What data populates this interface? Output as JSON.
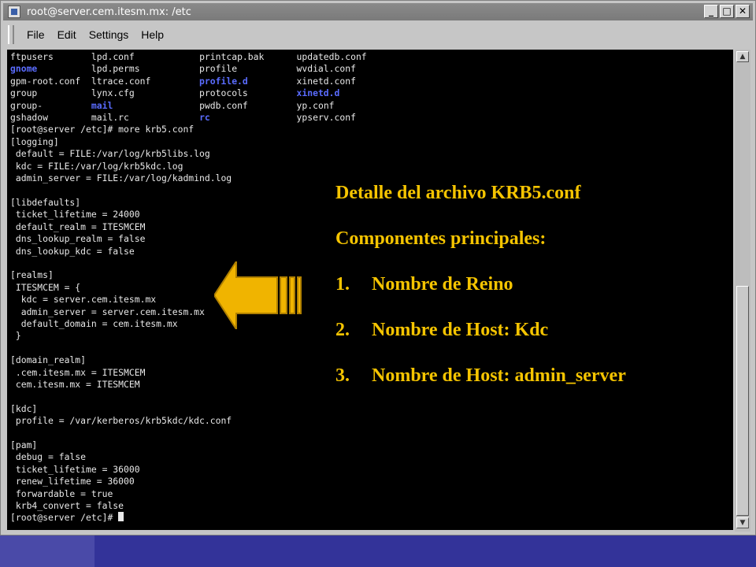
{
  "window": {
    "title": "root@server.cem.itesm.mx: /etc",
    "buttons": {
      "minimize": "_",
      "maximize": "□",
      "close": "✕"
    }
  },
  "menu": [
    "File",
    "Edit",
    "Settings",
    "Help"
  ],
  "terminal": {
    "listing": [
      [
        "ftpusers",
        "lpd.conf",
        "printcap.bak",
        "updatedb.conf"
      ],
      [
        "gnome",
        "lpd.perms",
        "profile",
        "wvdial.conf"
      ],
      [
        "gpm-root.conf",
        "ltrace.conf",
        "profile.d",
        "xinetd.conf"
      ],
      [
        "group",
        "lynx.cfg",
        "protocols",
        "xinetd.d"
      ],
      [
        "group-",
        "mail",
        "pwdb.conf",
        "yp.conf"
      ],
      [
        "gshadow",
        "mail.rc",
        "rc",
        "ypserv.conf"
      ]
    ],
    "lines": [
      "[root@server /etc]# more krb5.conf",
      "[logging]",
      " default = FILE:/var/log/krb5libs.log",
      " kdc = FILE:/var/log/krb5kdc.log",
      " admin_server = FILE:/var/log/kadmind.log",
      "",
      "[libdefaults]",
      " ticket_lifetime = 24000",
      " default_realm = ITESMCEM",
      " dns_lookup_realm = false",
      " dns_lookup_kdc = false",
      "",
      "[realms]",
      " ITESMCEM = {",
      "  kdc = server.cem.itesm.mx",
      "  admin_server = server.cem.itesm.mx",
      "  default_domain = cem.itesm.mx",
      " }",
      "",
      "[domain_realm]",
      " .cem.itesm.mx = ITESMCEM",
      " cem.itesm.mx = ITESMCEM",
      "",
      "[kdc]",
      " profile = /var/kerberos/krb5kdc/kdc.conf",
      "",
      "[pam]",
      " debug = false",
      " ticket_lifetime = 36000",
      " renew_lifetime = 36000",
      " forwardable = true",
      " krb4_convert = false"
    ],
    "prompt": "[root@server /etc]# "
  },
  "overlay": {
    "heading": "Detalle del archivo KRB5.conf",
    "subheading": "Componentes principales:",
    "items": [
      {
        "num": "1.",
        "text": "Nombre de Reino"
      },
      {
        "num": "2.",
        "text": "Nombre de Host: Kdc"
      },
      {
        "num": "3.",
        "text": "Nombre de Host: admin_server"
      }
    ]
  },
  "colors": {
    "terminal_bg": "#000000",
    "terminal_fg": "#e8e8e8",
    "directory": "#5a6cff",
    "overlay_text": "#f5c400",
    "arrow": "#f0b400",
    "slide_bg": "#333399"
  }
}
